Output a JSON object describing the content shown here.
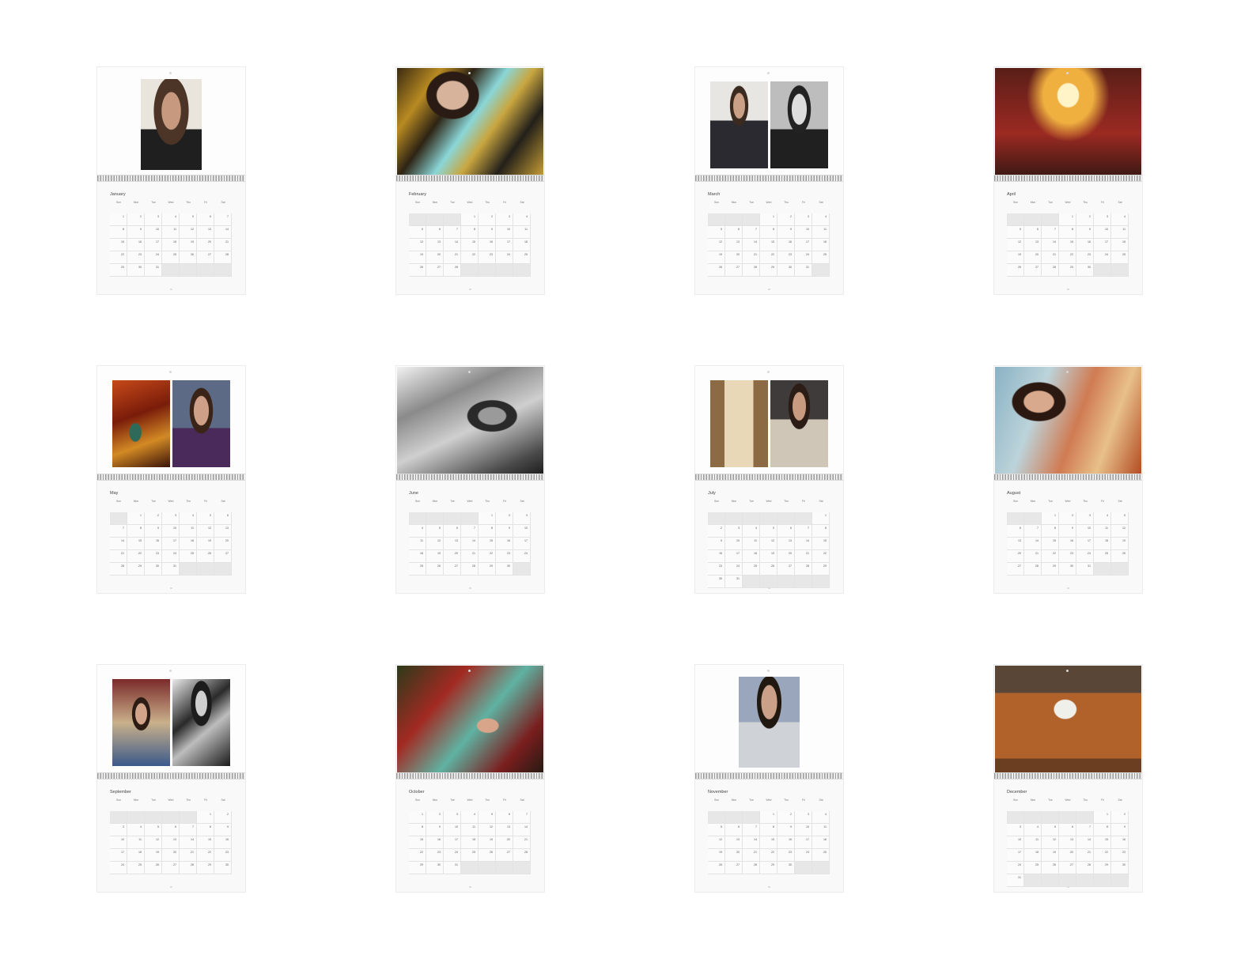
{
  "days_of_week": [
    "Sun",
    "Mon",
    "Tue",
    "Wed",
    "Thu",
    "Fri",
    "Sat"
  ],
  "months": [
    {
      "name": "January",
      "lead_blanks": 0,
      "days": 31,
      "photo_layout": "portrait-single",
      "photo": "portrait-photo"
    },
    {
      "name": "February",
      "lead_blanks": 3,
      "days": 28,
      "photo_layout": "full",
      "photo": "photo-floral-shirt"
    },
    {
      "name": "March",
      "lead_blanks": 3,
      "days": 31,
      "photo_layout": "pair",
      "photo": "photo-pair"
    },
    {
      "name": "April",
      "lead_blanks": 3,
      "days": 30,
      "photo_layout": "full",
      "photo": "photo-chandelier"
    },
    {
      "name": "May",
      "lead_blanks": 1,
      "days": 31,
      "photo_layout": "pair",
      "photo": "photo-pair"
    },
    {
      "name": "June",
      "lead_blanks": 4,
      "days": 30,
      "photo_layout": "full",
      "photo": "photo-black-and-white"
    },
    {
      "name": "July",
      "lead_blanks": 6,
      "days": 31,
      "photo_layout": "pair",
      "photo": "photo-pair"
    },
    {
      "name": "August",
      "lead_blanks": 2,
      "days": 31,
      "photo_layout": "full",
      "photo": "photo-heater"
    },
    {
      "name": "September",
      "lead_blanks": 5,
      "days": 30,
      "photo_layout": "pair",
      "photo": "photo-pair"
    },
    {
      "name": "October",
      "lead_blanks": 0,
      "days": 31,
      "photo_layout": "full",
      "photo": "photo-reclining"
    },
    {
      "name": "November",
      "lead_blanks": 3,
      "days": 30,
      "photo_layout": "portrait-single",
      "photo": "portrait-photo"
    },
    {
      "name": "December",
      "lead_blanks": 5,
      "days": 31,
      "photo_layout": "full",
      "photo": "photo-sofa-dog"
    }
  ]
}
